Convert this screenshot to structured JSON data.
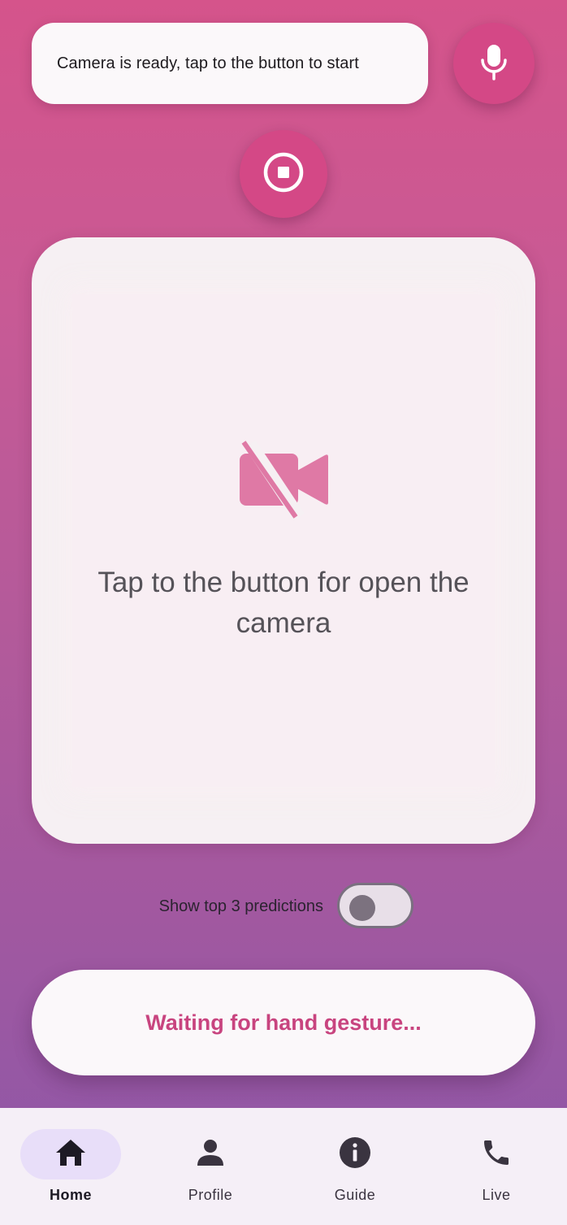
{
  "status": {
    "message": "Camera is ready, tap to the button to start"
  },
  "controls": {
    "mic_icon": "mic-icon",
    "stop_icon": "stop-circle-icon"
  },
  "camera_panel": {
    "icon": "videocam-off-icon",
    "message": "Tap to the button for open the camera"
  },
  "predictions_toggle": {
    "label": "Show top 3 predictions",
    "enabled": false
  },
  "result": {
    "text": "Waiting for hand gesture..."
  },
  "bottom_nav": {
    "items": [
      {
        "label": "Home",
        "icon": "home-icon",
        "active": true
      },
      {
        "label": "Profile",
        "icon": "person-icon",
        "active": false
      },
      {
        "label": "Guide",
        "icon": "info-icon",
        "active": false
      },
      {
        "label": "Live",
        "icon": "phone-icon",
        "active": false
      }
    ]
  },
  "colors": {
    "accent": "#d44886",
    "accent_text": "#c8447f",
    "camera_icon": "#df79a5",
    "gradient_top": "#d5548b",
    "gradient_bottom": "#8c57a8",
    "nav_active_pill": "#e8def9"
  }
}
